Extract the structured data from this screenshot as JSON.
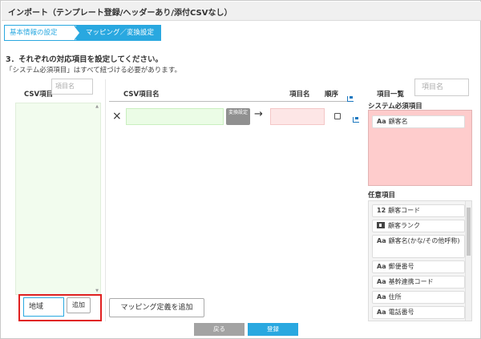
{
  "window": {
    "title": "インポート（テンプレート登録/ヘッダーあり/添付CSVなし）"
  },
  "steps": [
    {
      "label": "基本情報の設定",
      "active": false
    },
    {
      "label": "マッピング／変換設定",
      "active": true
    }
  ],
  "instructions": {
    "heading": "3．それぞれの対応項目を設定してください。",
    "note": "「システム必須項目」はすべて紐づける必要があります。"
  },
  "csv_panel": {
    "label": "CSV項目",
    "search_placeholder": "項目名",
    "new_item_value": "地域",
    "add_button": "追加"
  },
  "mapping": {
    "columns": {
      "csv_item": "CSV項目名",
      "item": "項目名",
      "order": "順序"
    },
    "row": {
      "remove_icon": "×",
      "convert_button": "変換設定",
      "arrow": "→",
      "order_checked": false
    },
    "add_button": "マッピング定義を追加"
  },
  "footer": {
    "back": "戻る",
    "register": "登録"
  },
  "item_list": {
    "label": "項目一覧",
    "search_placeholder": "項目名",
    "required_label": "システム必須項目",
    "required_items": [
      {
        "icon": "Aa",
        "label": "顧客名"
      }
    ],
    "optional_label": "任意項目",
    "optional_items": [
      {
        "icon": "12",
        "label": "顧客コード"
      },
      {
        "icon": "rank-icon",
        "label": "顧客ランク"
      },
      {
        "icon": "Aa",
        "label": "顧客名(かな/その他呼称)"
      },
      {
        "icon": "Aa",
        "label": "郵便番号"
      },
      {
        "icon": "Aa",
        "label": "基幹連携コード"
      },
      {
        "icon": "Aa",
        "label": "住所"
      },
      {
        "icon": "Aa",
        "label": "電話番号"
      }
    ]
  },
  "colors": {
    "accent": "#29a8e0",
    "required_bg": "#fecccc",
    "csv_bg": "#f2fcee",
    "highlight": "#e02020"
  }
}
